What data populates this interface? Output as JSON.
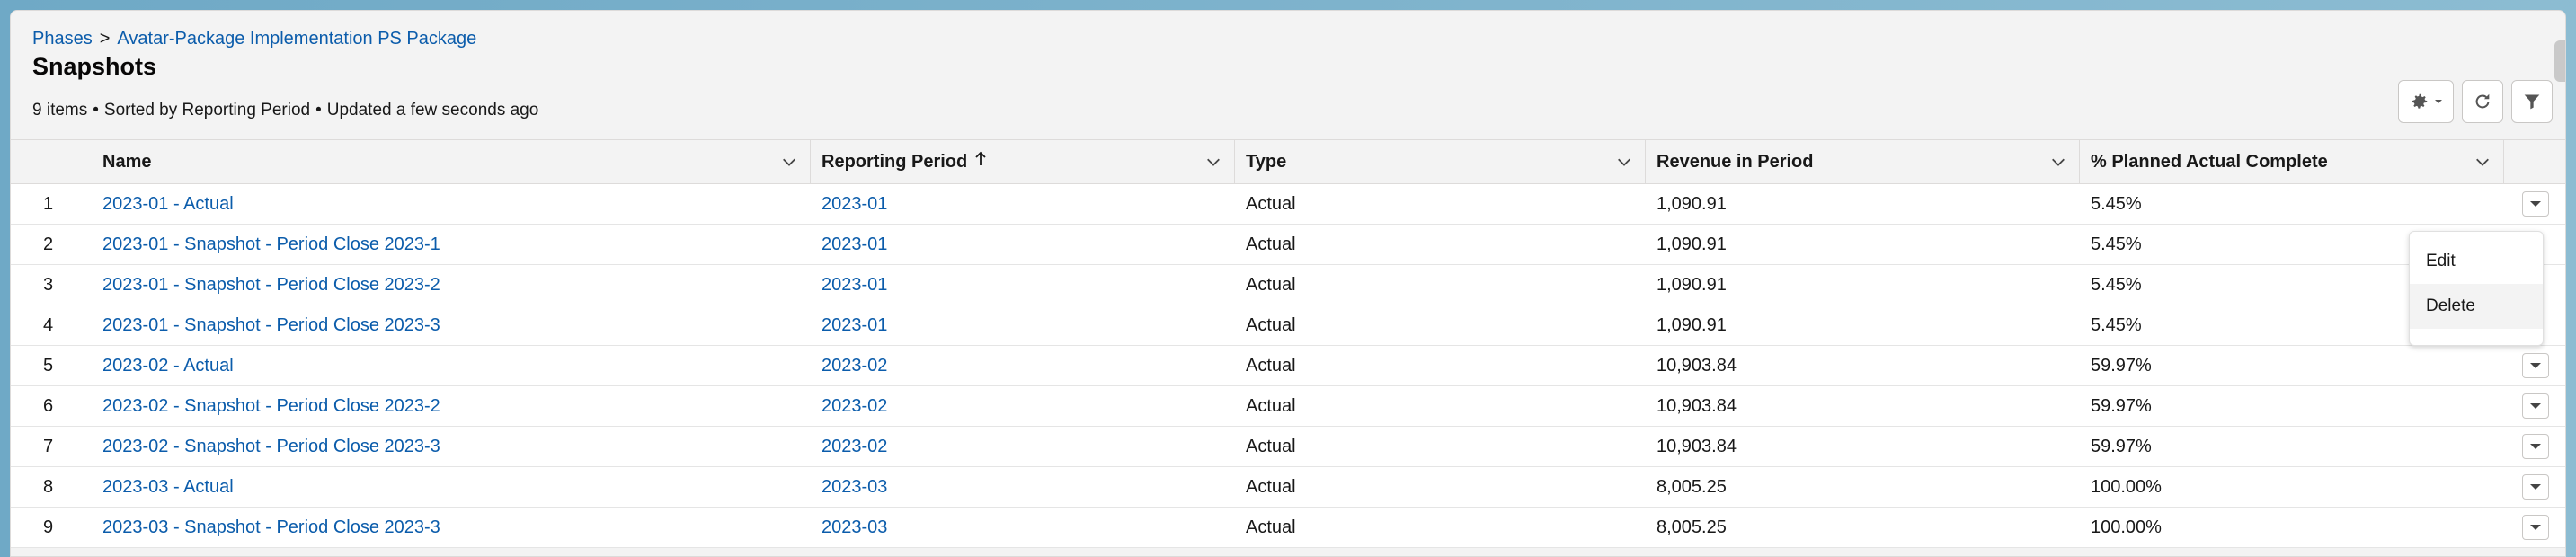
{
  "breadcrumb": {
    "parent": "Phases",
    "separator": ">",
    "current": "Avatar-Package Implementation PS Package"
  },
  "title": "Snapshots",
  "meta": {
    "count": "9 items",
    "sort": "Sorted by Reporting Period",
    "updated": "Updated a few seconds ago"
  },
  "icons": {
    "settings": "gear-icon",
    "refresh": "refresh-icon",
    "filter": "filter-icon"
  },
  "columns": {
    "name": "Name",
    "period": "Reporting Period",
    "type": "Type",
    "revenue": "Revenue in Period",
    "pct": "% Planned Actual Complete"
  },
  "rows": [
    {
      "num": "1",
      "name": "2023-01 - Actual",
      "period": "2023-01",
      "type": "Actual",
      "revenue": "1,090.91",
      "pct": "5.45%"
    },
    {
      "num": "2",
      "name": "2023-01 - Snapshot - Period Close 2023-1",
      "period": "2023-01",
      "type": "Actual",
      "revenue": "1,090.91",
      "pct": "5.45%"
    },
    {
      "num": "3",
      "name": "2023-01 - Snapshot - Period Close 2023-2",
      "period": "2023-01",
      "type": "Actual",
      "revenue": "1,090.91",
      "pct": "5.45%"
    },
    {
      "num": "4",
      "name": "2023-01 - Snapshot - Period Close 2023-3",
      "period": "2023-01",
      "type": "Actual",
      "revenue": "1,090.91",
      "pct": "5.45%"
    },
    {
      "num": "5",
      "name": "2023-02 - Actual",
      "period": "2023-02",
      "type": "Actual",
      "revenue": "10,903.84",
      "pct": "59.97%"
    },
    {
      "num": "6",
      "name": "2023-02 - Snapshot - Period Close 2023-2",
      "period": "2023-02",
      "type": "Actual",
      "revenue": "10,903.84",
      "pct": "59.97%"
    },
    {
      "num": "7",
      "name": "2023-02 - Snapshot - Period Close 2023-3",
      "period": "2023-02",
      "type": "Actual",
      "revenue": "10,903.84",
      "pct": "59.97%"
    },
    {
      "num": "8",
      "name": "2023-03 - Actual",
      "period": "2023-03",
      "type": "Actual",
      "revenue": "8,005.25",
      "pct": "100.00%"
    },
    {
      "num": "9",
      "name": "2023-03 - Snapshot - Period Close 2023-3",
      "period": "2023-03",
      "type": "Actual",
      "revenue": "8,005.25",
      "pct": "100.00%"
    }
  ],
  "row_menu": {
    "edit": "Edit",
    "delete": "Delete"
  },
  "colors": {
    "link": "#0b5cab",
    "header_bg": "#f3f3f3",
    "border": "#dddbda"
  }
}
